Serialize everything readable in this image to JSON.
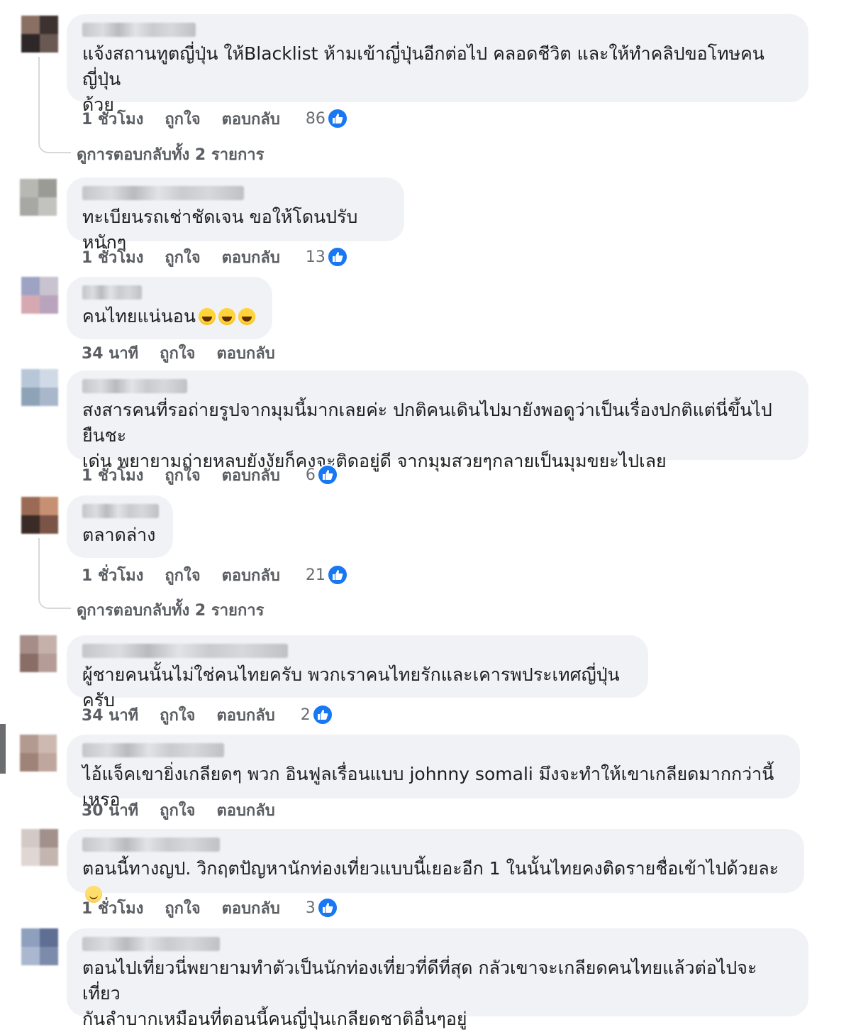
{
  "labels": {
    "like": "ถูกใจ",
    "reply": "ตอบกลับ"
  },
  "colors": {
    "bubble": "#f0f2f5",
    "like_blue": "#1877f2",
    "meta_gray": "#5a5d62"
  },
  "comments": [
    {
      "text": "แจ้งสถานทูตญี่ปุ่น ให้Blacklist ห้ามเข้าญี่ปุ่นอีกต่อไป คลอดชีวิต และให้ทำคลิปขอโทษคนญี่ปุ่น\nด้วย",
      "time": "1 ชั่วโมง",
      "likes": "86",
      "replies": "ดูการตอบกลับทั้ง 2 รายการ"
    },
    {
      "text": "ทะเบียนรถเช่าชัดเจน ขอให้โดนปรับหนักๆ",
      "time": "1 ชั่วโมง",
      "likes": "13"
    },
    {
      "text": "คนไทยแน่นอน",
      "time": "34 นาที",
      "emoji": "laughing-face-x3"
    },
    {
      "text": "สงสารคนที่รอถ่ายรูปจากมุมนี้มากเลยค่ะ ปกติคนเดินไปมายังพอดูว่าเป็นเรื่องปกติแต่นี่ขึ้นไปยืนชะ\nเด่น พยายามถ่ายหลบยังงัยก็คงจะติดอยู่ดี จากมุมสวยๆกลายเป็นมุมขยะไปเลย",
      "time": "1 ชั่วโมง",
      "likes": "6"
    },
    {
      "text": "ตลาดล่าง",
      "time": "1 ชั่วโมง",
      "likes": "21",
      "replies": "ดูการตอบกลับทั้ง 2 รายการ"
    },
    {
      "text": "ผู้ชายคนนั้นไม่ใช่คนไทยครับ พวกเราคนไทยรักและเคารพประเทศญี่ปุ่นครับ",
      "time": "34 นาที",
      "likes": "2"
    },
    {
      "text": "ไอ้แจ็คเขายิ่งเกลียดๆ พวก อินฟูลเรื่อนแบบ johnny somali มึงจะทำให้เขาเกลียดมากกว่านี้เหรอ",
      "time": "30 นาที"
    },
    {
      "text": "ตอนนี้ทางญป. วิกฤตปัญหานักท่องเที่ยวแบบนี้เยอะอีก 1 ในนั้นไทยคงติดรายชื่อเข้าไปด้วยละ",
      "time": "1 ชั่วโมง",
      "likes": "3",
      "emoji": "smiling-face"
    },
    {
      "text": "ตอนไปเที่ยวนี่พยายามทำตัวเป็นนักท่องเที่ยวที่ดีที่สุด กลัวเขาจะเกลียดคนไทยแล้วต่อไปจะเที่ยว\nกันลำบากเหมือนที่ตอนนี้คนญี่ปุ่นเกลียดชาติอื่นๆอยู่"
    }
  ]
}
